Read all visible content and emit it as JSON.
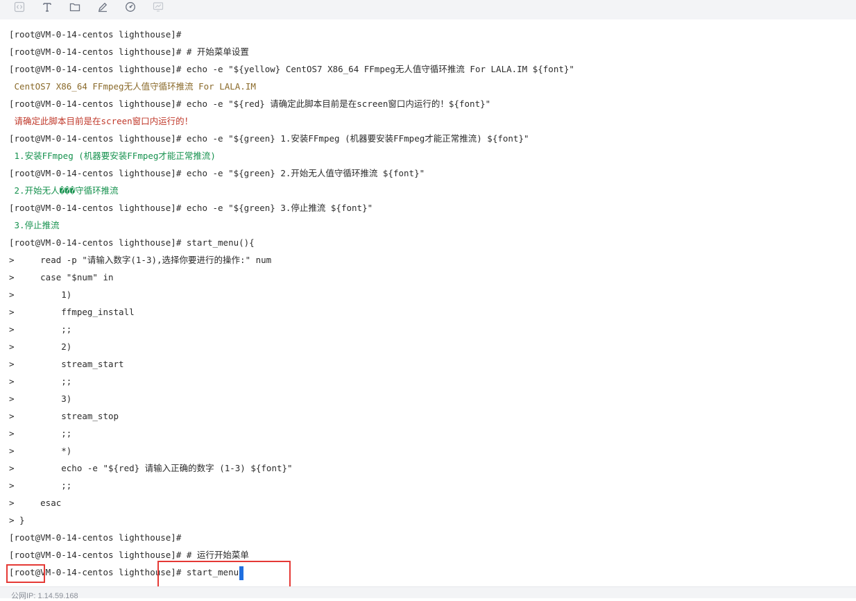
{
  "toolbar": {
    "icons": [
      "code-icon",
      "text-icon",
      "folder-icon",
      "edit-icon",
      "dashboard-icon",
      "monitor-icon"
    ],
    "icon_color": "#8a8f98"
  },
  "terminal": {
    "lines": [
      {
        "text": "[root@VM-0-14-centos lighthouse]#",
        "color": "default"
      },
      {
        "text": "[root@VM-0-14-centos lighthouse]# # 开始菜单设置",
        "color": "default"
      },
      {
        "text": "[root@VM-0-14-centos lighthouse]# echo -e \"${yellow} CentOS7 X86_64 FFmpeg无人值守循环推流 For LALA.IM ${font}\"",
        "color": "default"
      },
      {
        "text": " CentOS7 X86_64 FFmpeg无人值守循环推流 For LALA.IM",
        "color": "yellow"
      },
      {
        "text": "[root@VM-0-14-centos lighthouse]# echo -e \"${red} 请确定此脚本目前是在screen窗口内运行的！${font}\"",
        "color": "default"
      },
      {
        "text": " 请确定此脚本目前是在screen窗口内运行的！",
        "color": "red"
      },
      {
        "text": "[root@VM-0-14-centos lighthouse]# echo -e \"${green} 1.安装FFmpeg (机器要安装FFmpeg才能正常推流) ${font}\"",
        "color": "default"
      },
      {
        "text": " 1.安装FFmpeg (机器要安装FFmpeg才能正常推流)",
        "color": "green"
      },
      {
        "text": "[root@VM-0-14-centos lighthouse]# echo -e \"${green} 2.开始无人值守循环推流 ${font}\"",
        "color": "default"
      },
      {
        "text": " 2.开始无人���守循环推流",
        "color": "green"
      },
      {
        "text": "[root@VM-0-14-centos lighthouse]# echo -e \"${green} 3.停止推流 ${font}\"",
        "color": "default"
      },
      {
        "text": " 3.停止推流",
        "color": "green"
      },
      {
        "text": "[root@VM-0-14-centos lighthouse]# start_menu(){",
        "color": "default"
      },
      {
        "text": ">     read -p \"请输入数字(1-3),选择你要进行的操作:\" num",
        "color": "default"
      },
      {
        "text": ">     case \"$num\" in",
        "color": "default"
      },
      {
        "text": ">         1)",
        "color": "default"
      },
      {
        "text": ">         ffmpeg_install",
        "color": "default"
      },
      {
        "text": ">         ;;",
        "color": "default"
      },
      {
        "text": ">         2)",
        "color": "default"
      },
      {
        "text": ">         stream_start",
        "color": "default"
      },
      {
        "text": ">         ;;",
        "color": "default"
      },
      {
        "text": ">         3)",
        "color": "default"
      },
      {
        "text": ">         stream_stop",
        "color": "default"
      },
      {
        "text": ">         ;;",
        "color": "default"
      },
      {
        "text": ">         *)",
        "color": "default"
      },
      {
        "text": ">         echo -e \"${red} 请输入正确的数字 (1-3) ${font}\"",
        "color": "default"
      },
      {
        "text": ">         ;;",
        "color": "default"
      },
      {
        "text": ">     esac",
        "color": "default"
      },
      {
        "text": "> }",
        "color": "default"
      },
      {
        "text": "[root@VM-0-14-centos lighthouse]#",
        "color": "default"
      },
      {
        "text": "[root@VM-0-14-centos lighthouse]# # 运行开始菜单",
        "color": "default"
      },
      {
        "text": "[root@VM-0-14-centos lighthouse]# start_menu",
        "color": "default",
        "cursor": true
      }
    ]
  },
  "status_bar": {
    "text": "公网IP: 1.14.59.168"
  },
  "colors": {
    "yellow": "#8a6a2a",
    "red": "#c0392b",
    "green": "#17924f",
    "cursor": "#1f6fe0",
    "highlight_box": "#e53935"
  }
}
